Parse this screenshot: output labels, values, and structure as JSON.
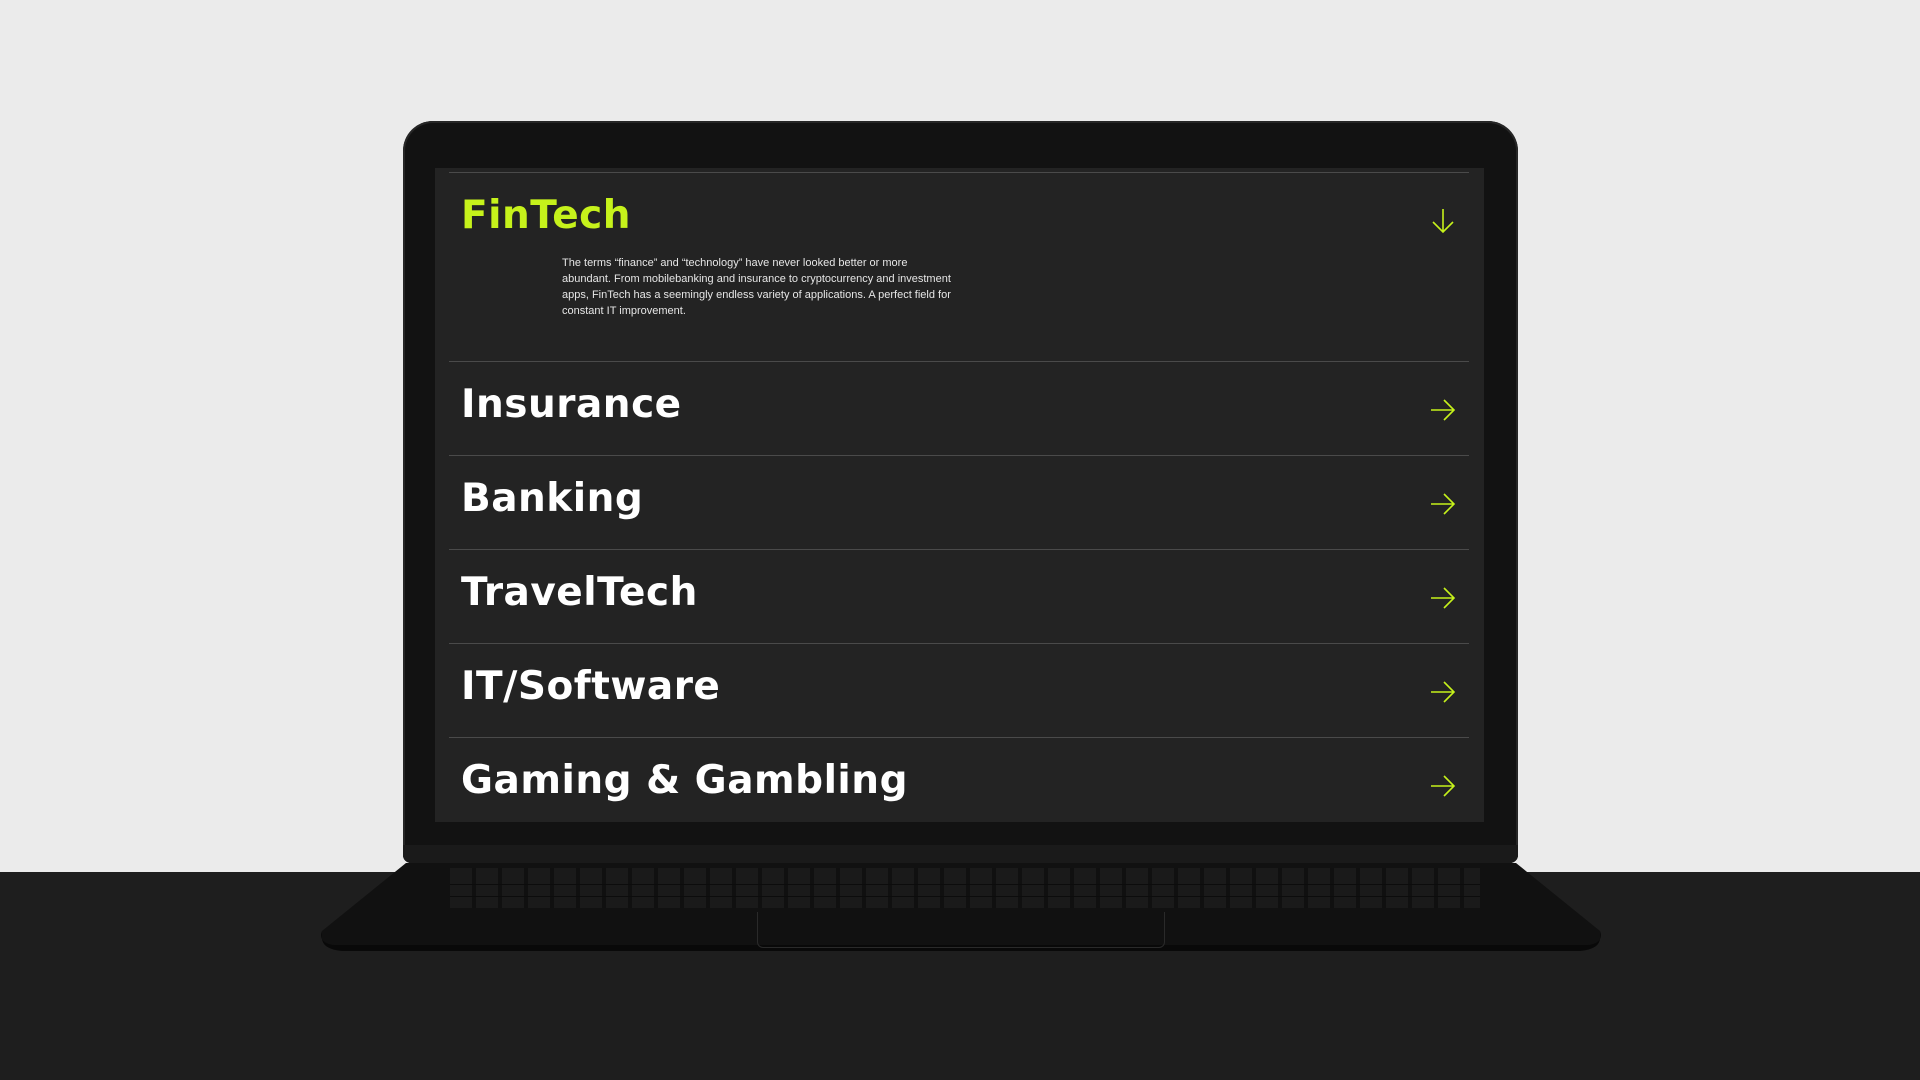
{
  "accent_color": "#c6f21b",
  "screen_background": "#232323",
  "industries": [
    {
      "title": "FinTech",
      "expanded": true,
      "icon": "arrow-down-icon",
      "description": "The terms “finance” and “technology” have never looked better or more abundant. From mobilebanking and insurance to cryptocurrency and investment apps, FinTech has a seemingly endless variety of applications. A perfect field for constant IT improvement."
    },
    {
      "title": "Insurance",
      "expanded": false,
      "icon": "arrow-right-icon"
    },
    {
      "title": "Banking",
      "expanded": false,
      "icon": "arrow-right-icon"
    },
    {
      "title": "TravelTech",
      "expanded": false,
      "icon": "arrow-right-icon"
    },
    {
      "title": "IT/Software",
      "expanded": false,
      "icon": "arrow-right-icon"
    },
    {
      "title": "Gaming & Gambling",
      "expanded": false,
      "icon": "arrow-right-icon"
    }
  ]
}
